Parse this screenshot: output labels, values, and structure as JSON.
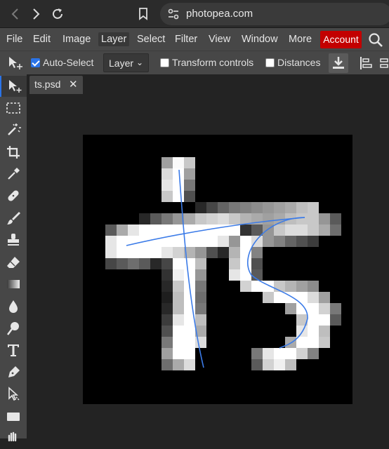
{
  "browser": {
    "url": "photopea.com",
    "icons": [
      "back-icon",
      "forward-icon",
      "reload-icon",
      "bookmark-icon",
      "site-info-icon"
    ]
  },
  "menu": {
    "items": [
      "File",
      "Edit",
      "Image",
      "Layer",
      "Select",
      "Filter",
      "View",
      "Window",
      "More"
    ],
    "active": "Layer",
    "account": "Account",
    "account_color": "#c30000"
  },
  "options": {
    "auto_select_label": "Auto-Select",
    "auto_select_checked": true,
    "auto_select_target": "Layer",
    "transform_controls_label": "Transform controls",
    "transform_controls_checked": false,
    "distances_label": "Distances",
    "distances_checked": false
  },
  "toolbar": {
    "tools": [
      "move-tool",
      "marquee-tool",
      "magic-wand-tool",
      "crop-tool",
      "eyedropper-tool",
      "healing-tool",
      "brush-tool",
      "stamp-tool",
      "eraser-tool",
      "gradient-tool",
      "blur-tool",
      "dodge-tool",
      "type-tool",
      "pen-tool",
      "path-select-tool",
      "shape-tool",
      "hand-tool"
    ],
    "selected": "move-tool"
  },
  "document": {
    "tab_name": "ts.psd",
    "stroke_color": "#3b7be8"
  }
}
